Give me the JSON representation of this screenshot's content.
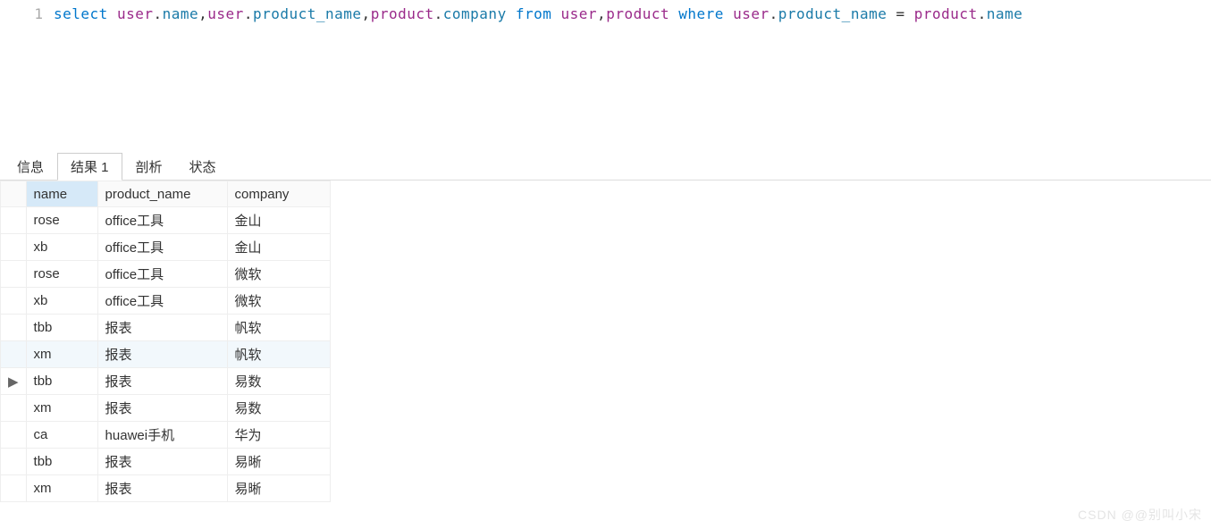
{
  "editor": {
    "line_no": "1",
    "sql": {
      "t": [
        {
          "c": "kw",
          "v": "select"
        },
        {
          "c": "sp",
          "v": " "
        },
        {
          "c": "tbl",
          "v": "user"
        },
        {
          "c": "dot",
          "v": "."
        },
        {
          "c": "col",
          "v": "name"
        },
        {
          "c": "punc",
          "v": ","
        },
        {
          "c": "tbl",
          "v": "user"
        },
        {
          "c": "dot",
          "v": "."
        },
        {
          "c": "col",
          "v": "product_name"
        },
        {
          "c": "punc",
          "v": ","
        },
        {
          "c": "tbl",
          "v": "product"
        },
        {
          "c": "dot",
          "v": "."
        },
        {
          "c": "col",
          "v": "company"
        },
        {
          "c": "sp",
          "v": " "
        },
        {
          "c": "kw",
          "v": "from"
        },
        {
          "c": "sp",
          "v": " "
        },
        {
          "c": "tbl",
          "v": "user"
        },
        {
          "c": "punc",
          "v": ","
        },
        {
          "c": "tbl",
          "v": "product"
        },
        {
          "c": "sp",
          "v": " "
        },
        {
          "c": "kw",
          "v": "where"
        },
        {
          "c": "sp",
          "v": " "
        },
        {
          "c": "tbl",
          "v": "user"
        },
        {
          "c": "dot",
          "v": "."
        },
        {
          "c": "col",
          "v": "product_name"
        },
        {
          "c": "sp",
          "v": " "
        },
        {
          "c": "op",
          "v": "="
        },
        {
          "c": "sp",
          "v": " "
        },
        {
          "c": "tbl",
          "v": "product"
        },
        {
          "c": "dot",
          "v": "."
        },
        {
          "c": "col",
          "v": "name"
        }
      ]
    }
  },
  "tabs": [
    {
      "label": "信息",
      "active": false
    },
    {
      "label": "结果 1",
      "active": true
    },
    {
      "label": "剖析",
      "active": false
    },
    {
      "label": "状态",
      "active": false
    }
  ],
  "grid": {
    "selected_col_index": 0,
    "current_row_index": 6,
    "columns": [
      "name",
      "product_name",
      "company"
    ],
    "rows": [
      [
        "rose",
        "office工具",
        "金山"
      ],
      [
        "xb",
        "office工具",
        "金山"
      ],
      [
        "rose",
        "office工具",
        "微软"
      ],
      [
        "xb",
        "office工具",
        "微软"
      ],
      [
        "tbb",
        "报表",
        "帆软"
      ],
      [
        "xm",
        "报表",
        "帆软"
      ],
      [
        "tbb",
        "报表",
        "易数"
      ],
      [
        "xm",
        "报表",
        "易数"
      ],
      [
        "ca",
        "huawei手机",
        "华为"
      ],
      [
        "tbb",
        "报表",
        "易晰"
      ],
      [
        "xm",
        "报表",
        "易晰"
      ]
    ]
  },
  "watermark": "CSDN @@别叫小宋"
}
